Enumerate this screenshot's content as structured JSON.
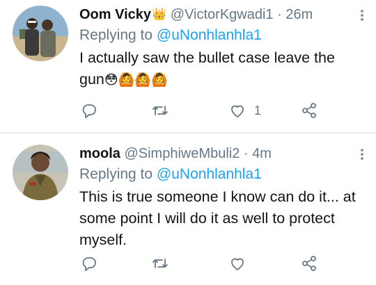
{
  "tweets": [
    {
      "name": "Oom Vicky",
      "name_emoji": "👑",
      "handle": "@VictorKgwadi1",
      "separator": "·",
      "time": "26m",
      "replying_label": "Replying to",
      "replying_to": "@uNonhlanhla1",
      "text": "I actually saw the bullet case leave the gun",
      "text_emoji": "😳🙆🙆🙆",
      "like_count": "1"
    },
    {
      "name": "moola",
      "handle": "@SimphiweMbuli2",
      "separator": "·",
      "time": "4m",
      "replying_label": "Replying to",
      "replying_to": "@uNonhlanhla1",
      "text": "This is true someone I know can do it... at some point I will do it as well to protect myself."
    }
  ],
  "colors": {
    "accent": "#1da1f2",
    "secondary_text": "#657786",
    "icon": "#657786",
    "divider": "#e6ecf0"
  },
  "icons": [
    "more-icon",
    "reply-icon",
    "retweet-icon",
    "like-icon",
    "share-icon"
  ]
}
